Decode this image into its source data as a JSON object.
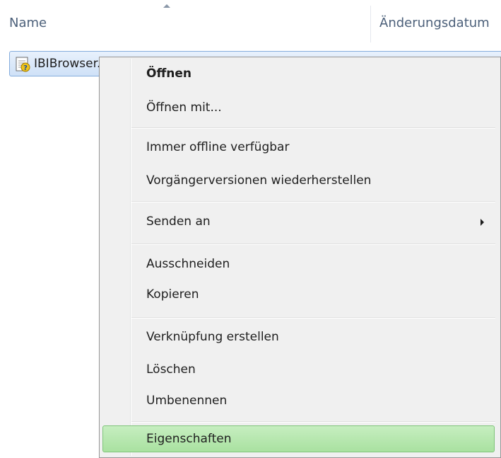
{
  "header": {
    "name_label": "Name",
    "date_label": "Änderungsdatum"
  },
  "file": {
    "name": "IBIBrowser.reg",
    "icon": "registry-file-icon"
  },
  "context_menu": {
    "open": "Öffnen",
    "open_with": "Öffnen mit...",
    "always_offline": "Immer offline verfügbar",
    "restore_previous": "Vorgängerversionen wiederherstellen",
    "send_to": "Senden an",
    "cut": "Ausschneiden",
    "copy": "Kopieren",
    "create_shortcut": "Verknüpfung erstellen",
    "delete": "Löschen",
    "rename": "Umbenennen",
    "properties": "Eigenschaften"
  },
  "colors": {
    "selection_fill": "#cfe1f7",
    "hover_fill": "#b8e8b0",
    "menu_background": "#f0f0f0"
  }
}
